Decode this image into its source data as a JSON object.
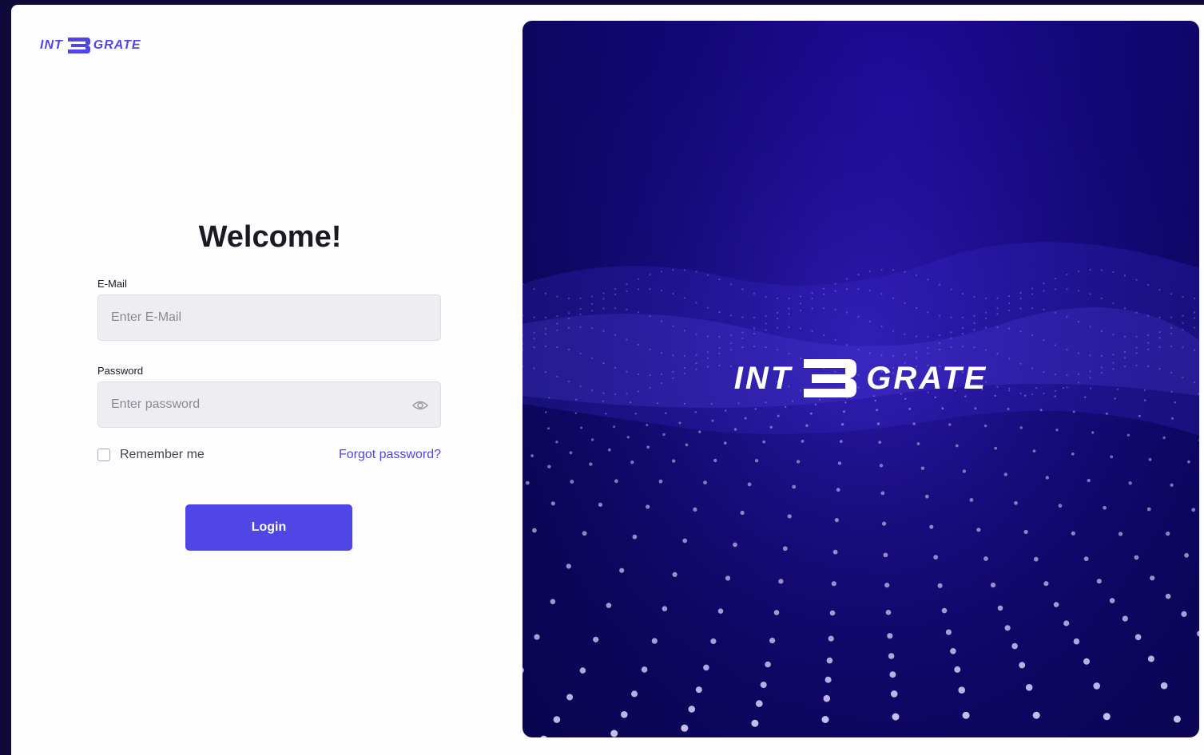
{
  "brand": {
    "name_left": "INT",
    "name_right": "GRATE",
    "accent_color": "#4f46e5"
  },
  "login": {
    "heading": "Welcome!",
    "email_label": "E-Mail",
    "email_placeholder": "Enter E-Mail",
    "password_label": "Password",
    "password_placeholder": "Enter password",
    "remember_label": "Remember me",
    "forgot_label": "Forgot password?",
    "submit_label": "Login"
  },
  "icons": {
    "logo_mark": "stylized-3-icon",
    "password_toggle": "eye-icon"
  }
}
